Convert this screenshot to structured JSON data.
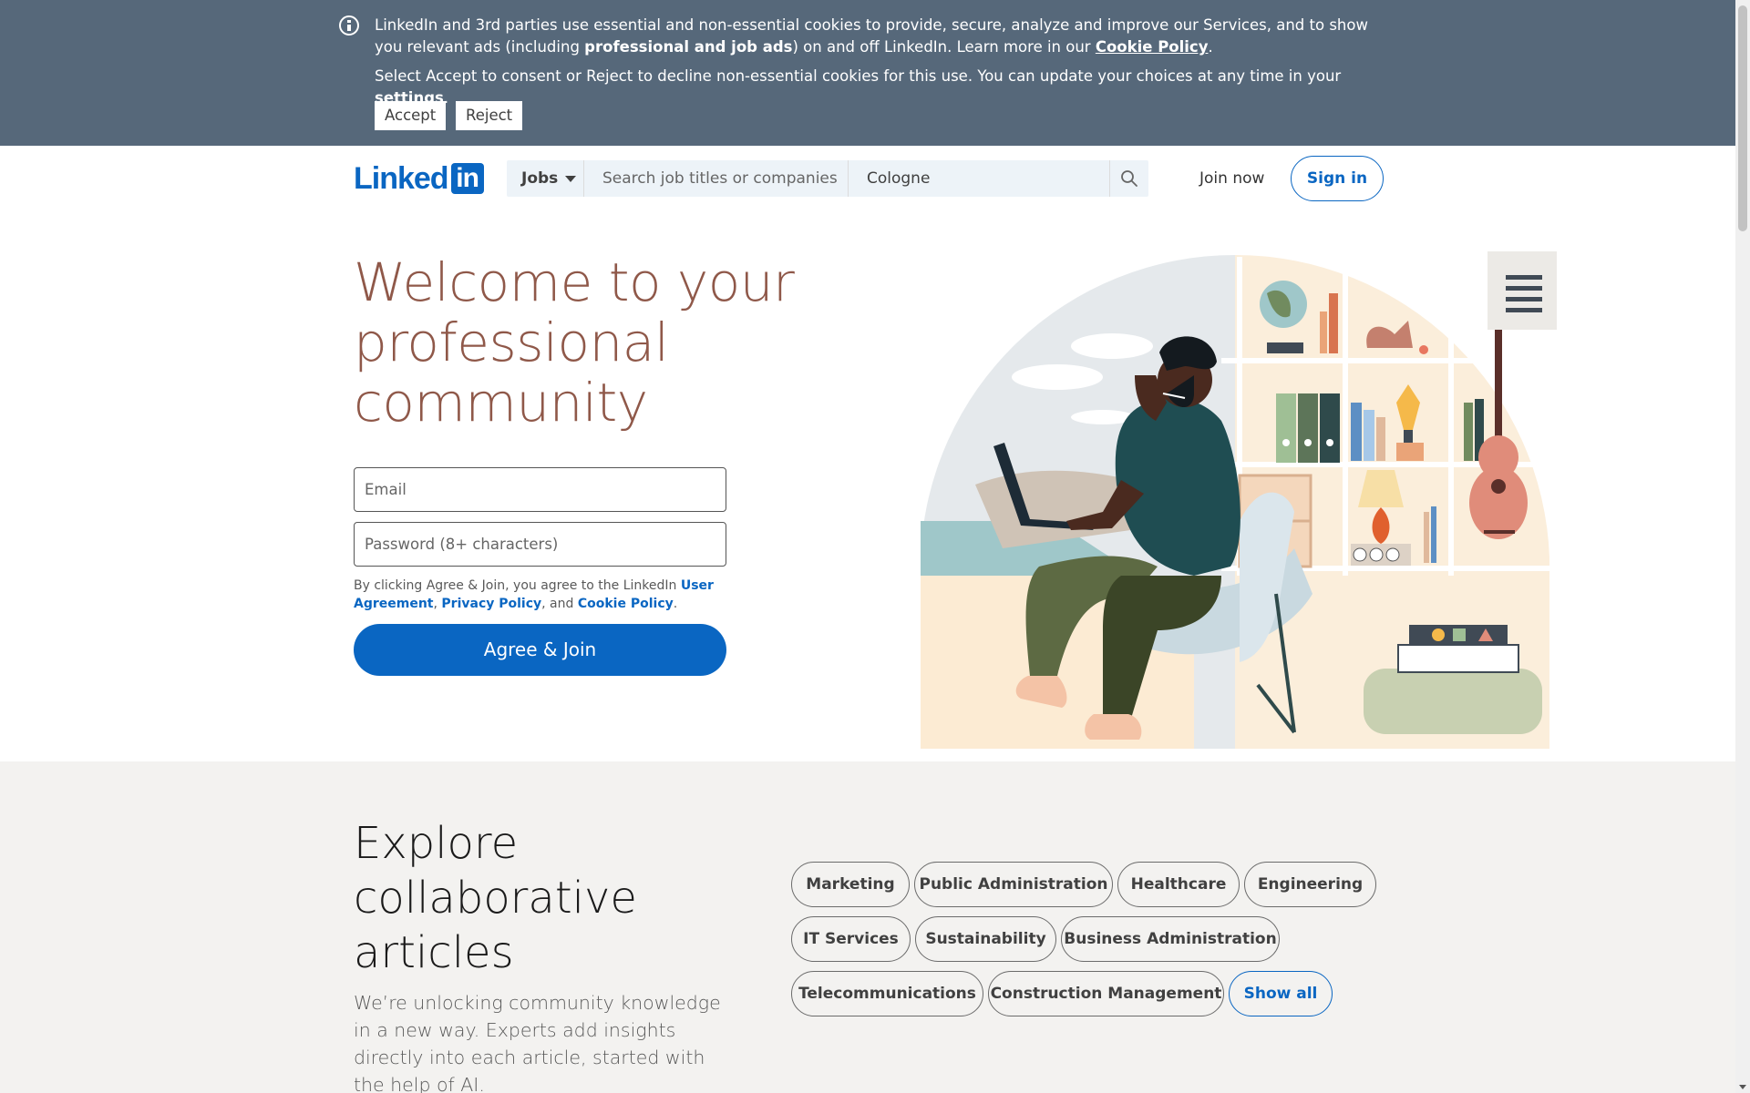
{
  "cookie_banner": {
    "text_part1": "LinkedIn and 3rd parties use essential and non-essential cookies to provide, secure, analyze and improve our Services, and to show you relevant ads (including ",
    "text_bold": "professional and job ads",
    "text_part2": ") on and off LinkedIn. Learn more in our ",
    "cookie_policy_link": "Cookie Policy",
    "text_part3": ".",
    "line2_part1": "Select Accept to consent or Reject to decline non-essential cookies for this use. You can update your choices at any time in your ",
    "settings_link": "settings",
    "line2_part2": ".",
    "accept_label": "Accept",
    "reject_label": "Reject"
  },
  "header": {
    "logo_word": "Linked",
    "logo_box": "in",
    "jobs_label": "Jobs",
    "search_placeholder": "Search job titles or companies",
    "location_value": "Cologne",
    "join_now_label": "Join now",
    "sign_in_label": "Sign in"
  },
  "hero": {
    "title": "Welcome to your professional community",
    "email_placeholder": "Email",
    "password_placeholder": "Password (8+ characters)",
    "legal_prefix": "By clicking Agree & Join, you agree to the LinkedIn ",
    "user_agreement_link": "User Agreement",
    "legal_sep1": ", ",
    "privacy_link": "Privacy Policy",
    "legal_sep2": ", and ",
    "cookie_link": "Cookie Policy",
    "legal_end": ".",
    "agree_label": "Agree & Join"
  },
  "explore": {
    "title": "Explore collaborative articles",
    "description": "We’re unlocking community knowledge in a new way. Experts add insights directly into each article, started with the help of AI.",
    "topics": [
      "Marketing",
      "Public Administration",
      "Healthcare",
      "Engineering",
      "IT Services",
      "Sustainability",
      "Business Administration",
      "Telecommunications",
      "Construction Management"
    ],
    "show_all_label": "Show all"
  },
  "colors": {
    "brand_blue": "#0a66c2",
    "banner_bg": "#56687a",
    "hero_title": "#8f5849",
    "explore_bg": "#f3f2f0"
  }
}
